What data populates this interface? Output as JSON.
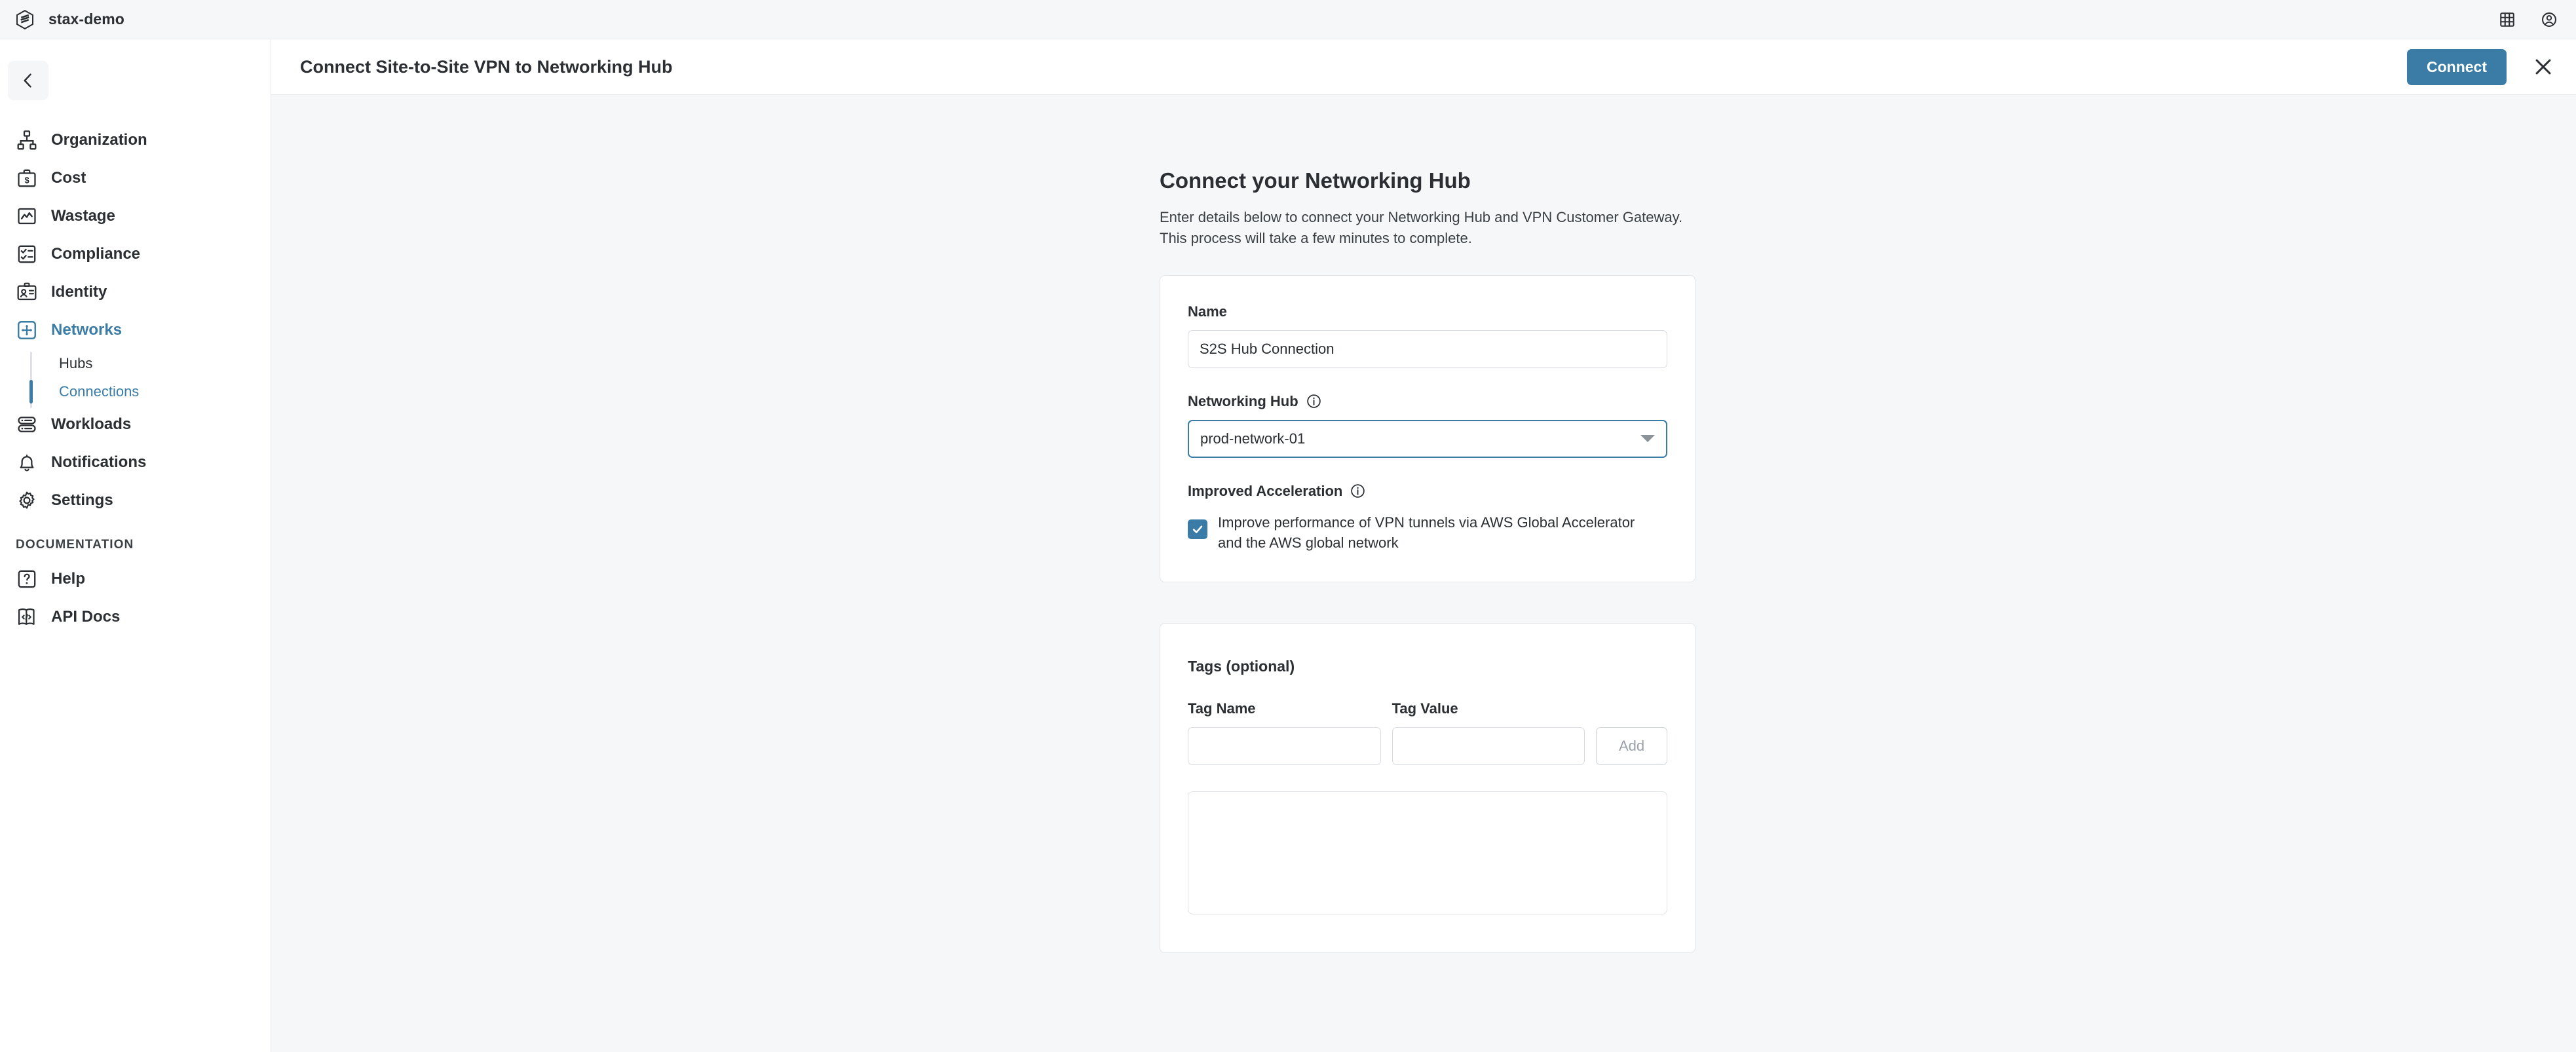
{
  "topbar": {
    "brand_name": "stax-demo",
    "logo_icon": "stax-hexagon-logo",
    "apps_icon": "grid-apps-icon",
    "account_icon": "user-account-icon"
  },
  "sidebar": {
    "back_icon": "chevron-left-icon",
    "items": [
      {
        "label": "Organization",
        "icon": "org-chart-icon",
        "active": false
      },
      {
        "label": "Cost",
        "icon": "briefcase-dollar-icon",
        "active": false
      },
      {
        "label": "Wastage",
        "icon": "chart-trend-icon",
        "active": false
      },
      {
        "label": "Compliance",
        "icon": "checklist-icon",
        "active": false
      },
      {
        "label": "Identity",
        "icon": "id-card-icon",
        "active": false
      },
      {
        "label": "Networks",
        "icon": "network-move-icon",
        "active": true
      }
    ],
    "subitems": [
      {
        "label": "Hubs",
        "active": false
      },
      {
        "label": "Connections",
        "active": true
      }
    ],
    "items_after": [
      {
        "label": "Workloads",
        "icon": "server-stack-icon",
        "active": false
      },
      {
        "label": "Notifications",
        "icon": "bell-icon",
        "active": false
      },
      {
        "label": "Settings",
        "icon": "gear-icon",
        "active": false
      }
    ],
    "documentation_heading": "DOCUMENTATION",
    "doc_items": [
      {
        "label": "Help",
        "icon": "question-box-icon"
      },
      {
        "label": "API Docs",
        "icon": "code-doc-icon"
      }
    ]
  },
  "content_header": {
    "title": "Connect Site-to-Site VPN to Networking Hub",
    "connect_label": "Connect",
    "close_icon": "close-x-icon"
  },
  "form": {
    "heading": "Connect your Networking Hub",
    "description": "Enter details below to connect your Networking Hub and VPN Customer Gateway. This process will take a few minutes to complete.",
    "name_label": "Name",
    "name_value": "S2S Hub Connection",
    "name_placeholder": "",
    "hub_label": "Networking Hub",
    "hub_info_icon": "info-circle-icon",
    "hub_value": "prod-network-01",
    "hub_caret_icon": "chevron-down-icon",
    "acceleration_label": "Improved Acceleration",
    "acceleration_info_icon": "info-circle-icon",
    "acceleration_checkbox_checked": true,
    "acceleration_text": "Improve performance of VPN tunnels via AWS Global Accelerator and the AWS global network"
  },
  "tags": {
    "title": "Tags (optional)",
    "name_label": "Tag Name",
    "name_value": "",
    "name_placeholder": "",
    "value_label": "Tag Value",
    "value_value": "",
    "value_placeholder": "",
    "add_label": "Add",
    "list_items": []
  },
  "colors": {
    "accent": "#3a7ca5",
    "page_bg": "#f6f7f9",
    "card_bg": "#ffffff",
    "border": "#e3e6e9",
    "text": "#2b2f33"
  }
}
